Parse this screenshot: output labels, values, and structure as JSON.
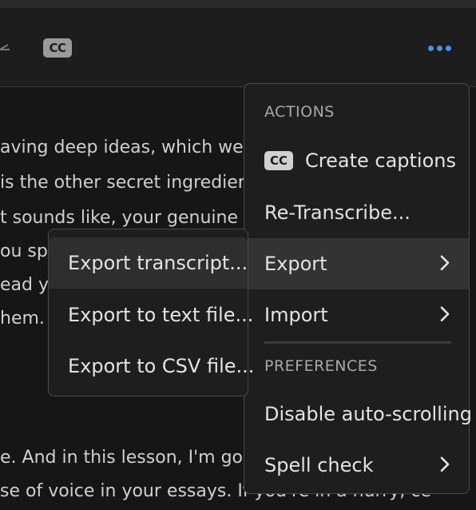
{
  "toolbar": {
    "cc_label": "CC"
  },
  "transcript": {
    "lines": [
      "aving deep ideas, which we c",
      "is the other secret ingredient",
      "t sounds like, your genuine vo",
      "ou spe",
      "ead y",
      "hem.",
      "e. And in this lesson, I'm goin",
      "se of voice in your essays. If you're in a hurry, ce"
    ]
  },
  "menu": {
    "actions_header": "ACTIONS",
    "create_captions": "Create captions",
    "cc_label": "CC",
    "retranscribe": "Re-Transcribe...",
    "export": "Export",
    "import": "Import",
    "preferences_header": "PREFERENCES",
    "disable_autoscroll": "Disable auto-scrolling",
    "spell_check": "Spell check"
  },
  "submenu": {
    "items": [
      "Export transcript...",
      "Export to text file...",
      "Export to CSV file..."
    ]
  },
  "colors": {
    "accent": "#4a90e2",
    "menu_bg": "#1e1e1e",
    "highlight": "#333333"
  }
}
